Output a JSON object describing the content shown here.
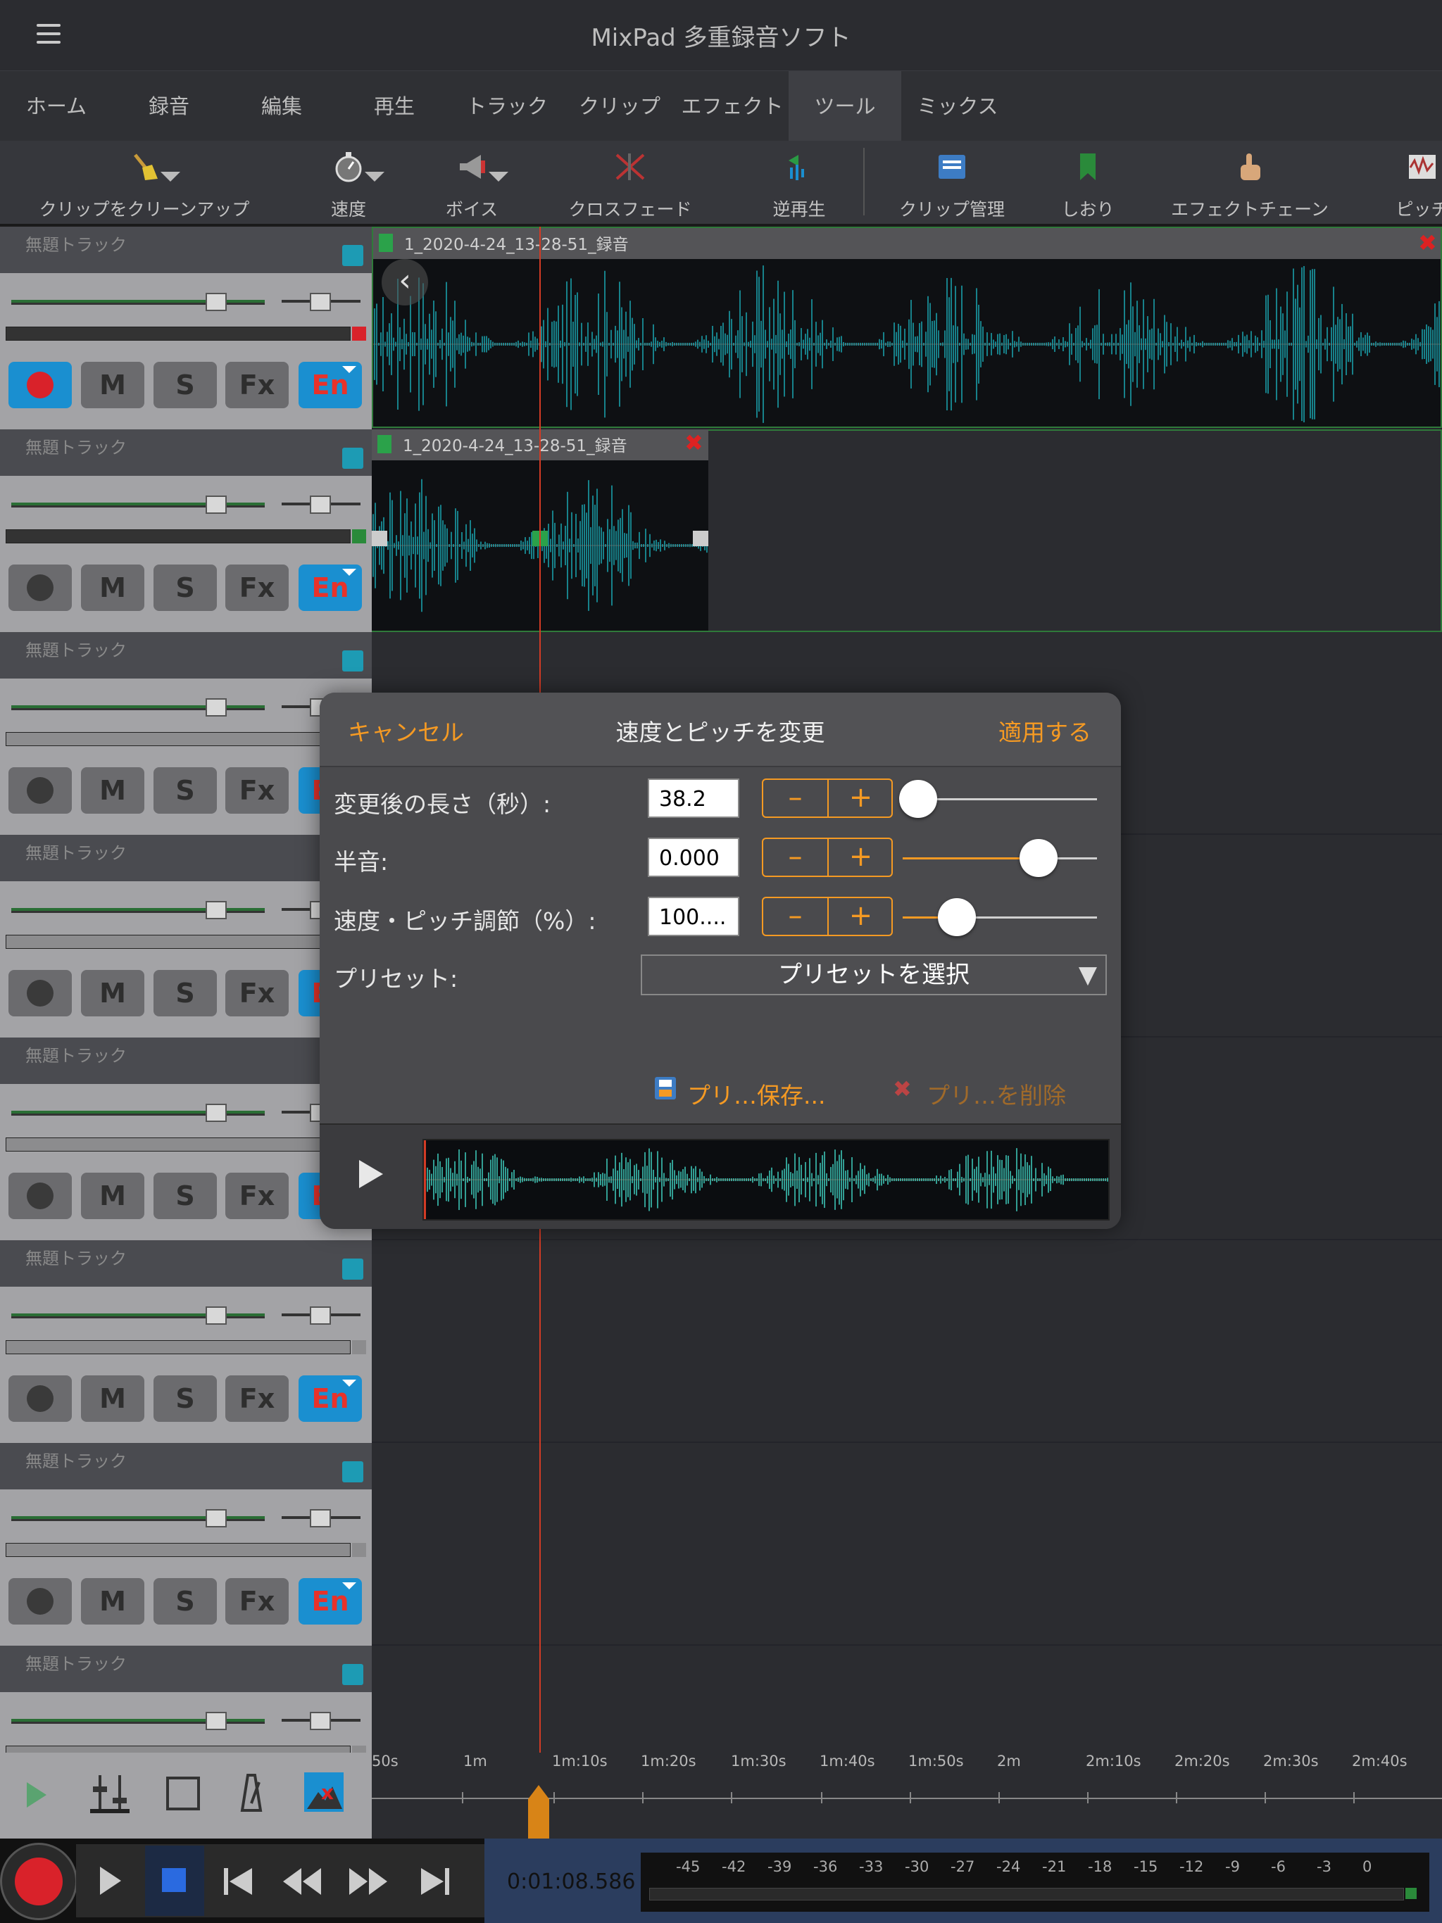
{
  "app": {
    "title": "MixPad 多重録音ソフト"
  },
  "tabs": [
    "ホーム",
    "録音",
    "編集",
    "再生",
    "トラック",
    "クリップ",
    "エフェクト",
    "ツール",
    "ミックス"
  ],
  "active_tab": "ツール",
  "toolbar": {
    "cleanup": "クリップをクリーンアップ",
    "speed": "速度",
    "voice": "ボイス",
    "crossfade": "クロスフェード",
    "reverse": "逆再生",
    "clip_manager": "クリップ管理",
    "bookmark": "しおり",
    "effect_chain": "エフェクトチェーン",
    "pitch": "ピッチ"
  },
  "tracks": {
    "name": "無題トラック",
    "m": "M",
    "s": "S",
    "fx": "Fx",
    "en": "En"
  },
  "clips": {
    "clip1_title": "1_2020-4-24_13-28-51_録音",
    "clip2_title": "1_2020-4-24_13-28-51_録音"
  },
  "dialog": {
    "cancel": "キャンセル",
    "title": "速度とピッチを変更",
    "apply": "適用する",
    "length_label": "変更後の長さ（秒）:",
    "length_value": "38.2",
    "length_slider": 0.08,
    "semitone_label": "半音:",
    "semitone_value": "0.000",
    "semitone_slider": 0.7,
    "rate_label": "速度・ピッチ調節（%）:",
    "rate_value": "100....",
    "rate_slider": 0.28,
    "preset_label": "プリセット:",
    "preset_select": "プリセットを選択",
    "save_preset": "プリ…保存...",
    "delete_preset": "プリ…を削除",
    "minus": "–",
    "plus": "+"
  },
  "ruler": [
    "50s",
    "1m",
    "1m:10s",
    "1m:20s",
    "1m:30s",
    "1m:40s",
    "1m:50s",
    "2m",
    "2m:10s",
    "2m:20s",
    "2m:30s",
    "2m:40s"
  ],
  "transport": {
    "time": "0:01:08.586",
    "meter_scale": [
      "-45",
      "-42",
      "-39",
      "-36",
      "-33",
      "-30",
      "-27",
      "-24",
      "-21",
      "-18",
      "-15",
      "-12",
      "-9",
      "-6",
      "-3",
      "0"
    ]
  },
  "colors": {
    "accent": "#f59a23",
    "waveform": "#1aa7b3",
    "record": "#d9222a",
    "en_blue": "#1a8fd0"
  }
}
